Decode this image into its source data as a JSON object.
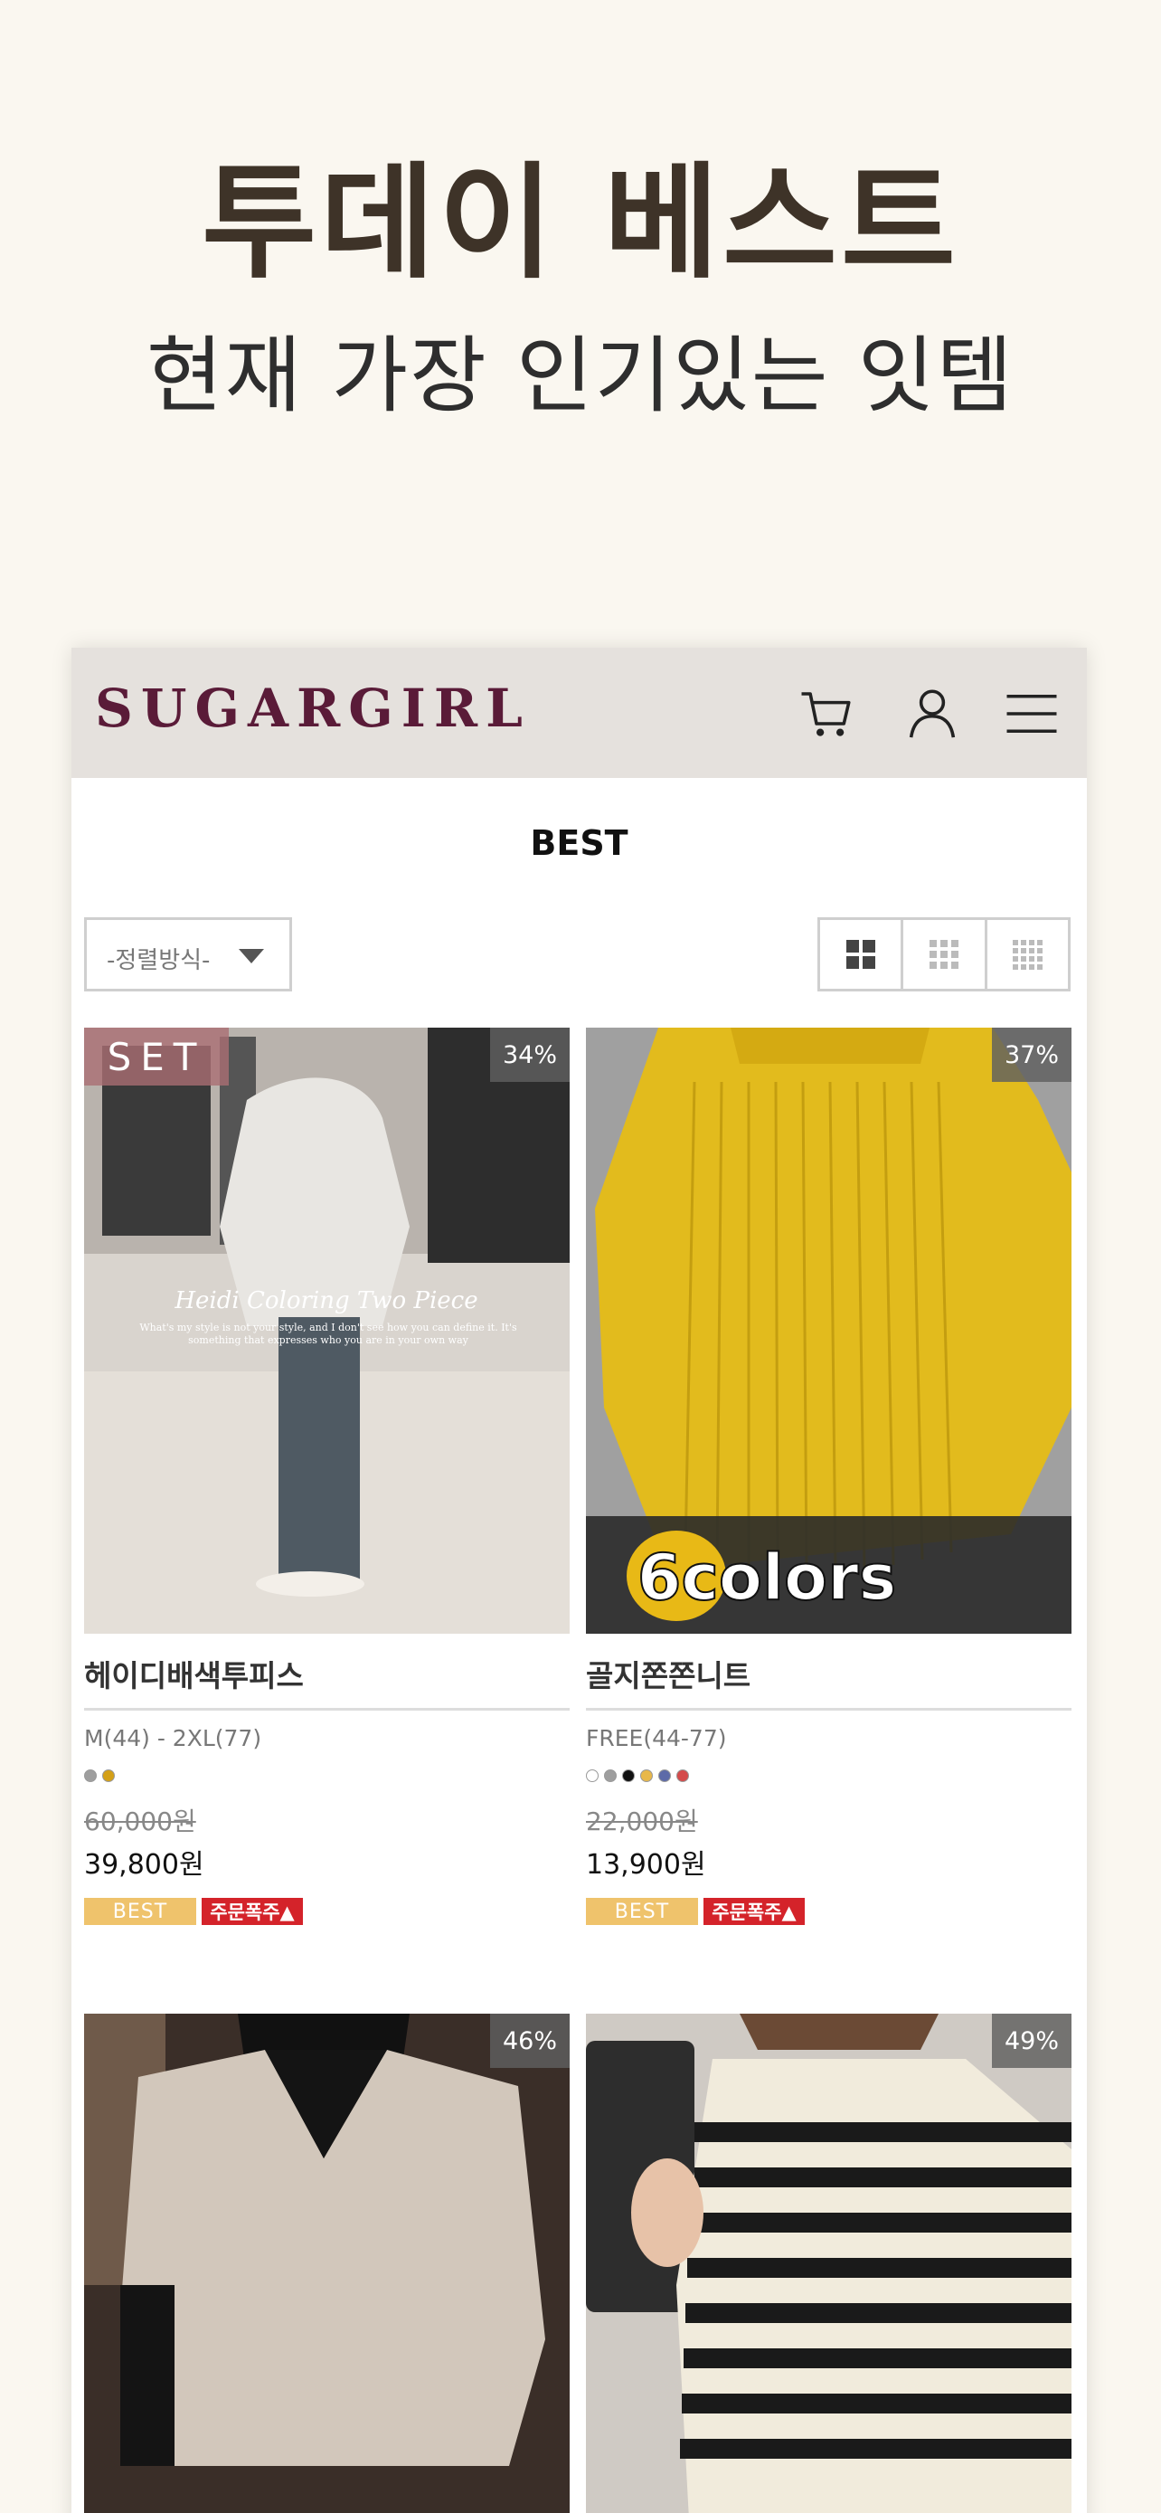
{
  "promo": {
    "title": "투데이 베스트",
    "subtitle": "현재 가장 인기있는 잇템"
  },
  "header": {
    "logo": "SUGARGIRL",
    "icons": [
      "cart-icon",
      "user-icon",
      "menu-icon"
    ]
  },
  "page_title": "BEST",
  "sort": {
    "label": "-정렬방식-"
  },
  "view_modes": [
    "grid-2",
    "grid-3",
    "grid-4"
  ],
  "products": [
    {
      "name": "헤이디배색투피스",
      "discount": "34%",
      "tag": "SET",
      "image_caption": "Heidi Coloring Two Piece",
      "image_text": "What's my style is not your style, and I don't see how you can define it. It's something that expresses who you are in your own way",
      "size": "M(44) - 2XL(77)",
      "colors": [
        "#9e9e9e",
        "#d4a017"
      ],
      "orig_price": "60,000원",
      "sale_price": "39,800원",
      "badges": {
        "best": "BEST",
        "hot": "주문폭주▲"
      }
    },
    {
      "name": "골지쫀쫀니트",
      "discount": "37%",
      "image_caption": "6colors",
      "size": "FREE(44-77)",
      "colors": [
        "#ffffff",
        "#9e9e9e",
        "#111111",
        "#e8b84a",
        "#5d6aa8",
        "#d44b4b"
      ],
      "orig_price": "22,000원",
      "sale_price": "13,900원",
      "badges": {
        "best": "BEST",
        "hot": "주문폭주▲"
      }
    },
    {
      "discount": "46%"
    },
    {
      "discount": "49%"
    }
  ],
  "colors": {
    "logo": "#5a1b38",
    "header_bg": "#e5e1dd",
    "best_badge": "#efc36c",
    "hot_badge": "#d4232a"
  }
}
